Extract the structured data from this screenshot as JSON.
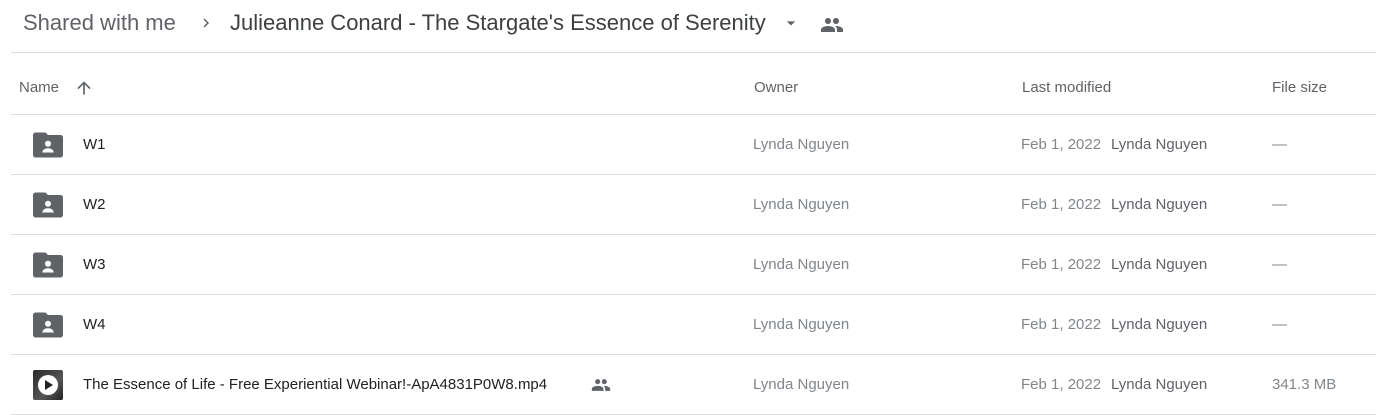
{
  "breadcrumb": {
    "root": "Shared with me",
    "current": "Julieanne Conard - The Stargate's Essence of Serenity"
  },
  "columns": {
    "name": "Name",
    "owner": "Owner",
    "last_modified": "Last modified",
    "file_size": "File size"
  },
  "rows": [
    {
      "name": "W1",
      "type": "shared-folder-icon",
      "owner": "Lynda Nguyen",
      "date": "Feb 1, 2022",
      "modified_by": "Lynda Nguyen",
      "size": "—"
    },
    {
      "name": "W2",
      "type": "shared-folder-icon",
      "owner": "Lynda Nguyen",
      "date": "Feb 1, 2022",
      "modified_by": "Lynda Nguyen",
      "size": "—"
    },
    {
      "name": "W3",
      "type": "shared-folder-icon",
      "owner": "Lynda Nguyen",
      "date": "Feb 1, 2022",
      "modified_by": "Lynda Nguyen",
      "size": "—"
    },
    {
      "name": "W4",
      "type": "shared-folder-icon",
      "owner": "Lynda Nguyen",
      "date": "Feb 1, 2022",
      "modified_by": "Lynda Nguyen",
      "size": "—"
    },
    {
      "name": "The Essence of Life - Free Experiential Webinar!-ApA4831P0W8.mp4",
      "type": "video-thumbnail-icon",
      "owner": "Lynda Nguyen",
      "date": "Feb 1, 2022",
      "modified_by": "Lynda Nguyen",
      "size": "341.3 MB"
    }
  ],
  "colors": {
    "border": "#dadce0",
    "icon": "#5f6368",
    "text_primary": "#202124",
    "text_secondary": "#80868b"
  }
}
